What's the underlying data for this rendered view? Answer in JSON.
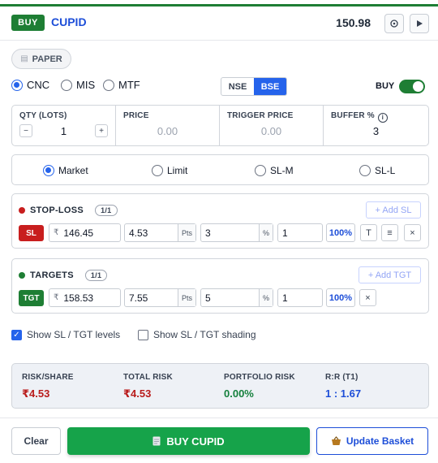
{
  "header": {
    "side_badge": "BUY",
    "symbol": "CUPID",
    "ltp": "150.98",
    "settings_icon": "gear-icon",
    "play_icon": "play-icon"
  },
  "mode_chip": "PAPER",
  "product": {
    "options": [
      "CNC",
      "MIS",
      "MTF"
    ],
    "selected": "CNC"
  },
  "exchange": {
    "options": [
      "NSE",
      "BSE"
    ],
    "selected": "BSE"
  },
  "side_toggle": {
    "label": "BUY",
    "on": true
  },
  "qty_row": {
    "qty_label": "QTY (LOTS)",
    "qty_value": "1",
    "minus": "−",
    "plus": "+",
    "price_label": "PRICE",
    "price_value": "0.00",
    "trigger_label": "TRIGGER PRICE",
    "trigger_value": "0.00",
    "buffer_label": "BUFFER %",
    "buffer_value": "3"
  },
  "order_types": {
    "options": [
      "Market",
      "Limit",
      "SL-M",
      "SL-L"
    ],
    "selected": "Market"
  },
  "stoploss": {
    "title": "STOP-LOSS",
    "count": "1/1",
    "add_label": "+ Add SL",
    "tag": "SL",
    "currency": "₹",
    "price": "146.45",
    "points": "4.53",
    "points_suffix": "Pts",
    "percent": "3",
    "percent_suffix": "%",
    "qty": "1",
    "qty_pct": "100%",
    "t_button": "T",
    "menu_button": "≡",
    "remove_button": "×",
    "color": "#c81e1e"
  },
  "targets": {
    "title": "TARGETS",
    "count": "1/1",
    "add_label": "+ Add TGT",
    "tag": "TGT",
    "currency": "₹",
    "price": "158.53",
    "points": "7.55",
    "points_suffix": "Pts",
    "percent": "5",
    "percent_suffix": "%",
    "qty": "1",
    "qty_pct": "100%",
    "remove_button": "×",
    "color": "#1e7e34"
  },
  "options": {
    "show_levels": {
      "label": "Show SL / TGT levels",
      "checked": true
    },
    "show_shading": {
      "label": "Show SL / TGT shading",
      "checked": false
    }
  },
  "risk": {
    "risk_share_label": "RISK/SHARE",
    "risk_share_value": "₹4.53",
    "total_risk_label": "TOTAL RISK",
    "total_risk_value": "₹4.53",
    "portfolio_risk_label": "PORTFOLIO RISK",
    "portfolio_risk_value": "0.00%",
    "rr_label": "R:R (T1)",
    "rr_value": "1 : 1.67"
  },
  "footer": {
    "clear_label": "Clear",
    "buy_label": "BUY CUPID",
    "basket_label": "Update Basket"
  }
}
